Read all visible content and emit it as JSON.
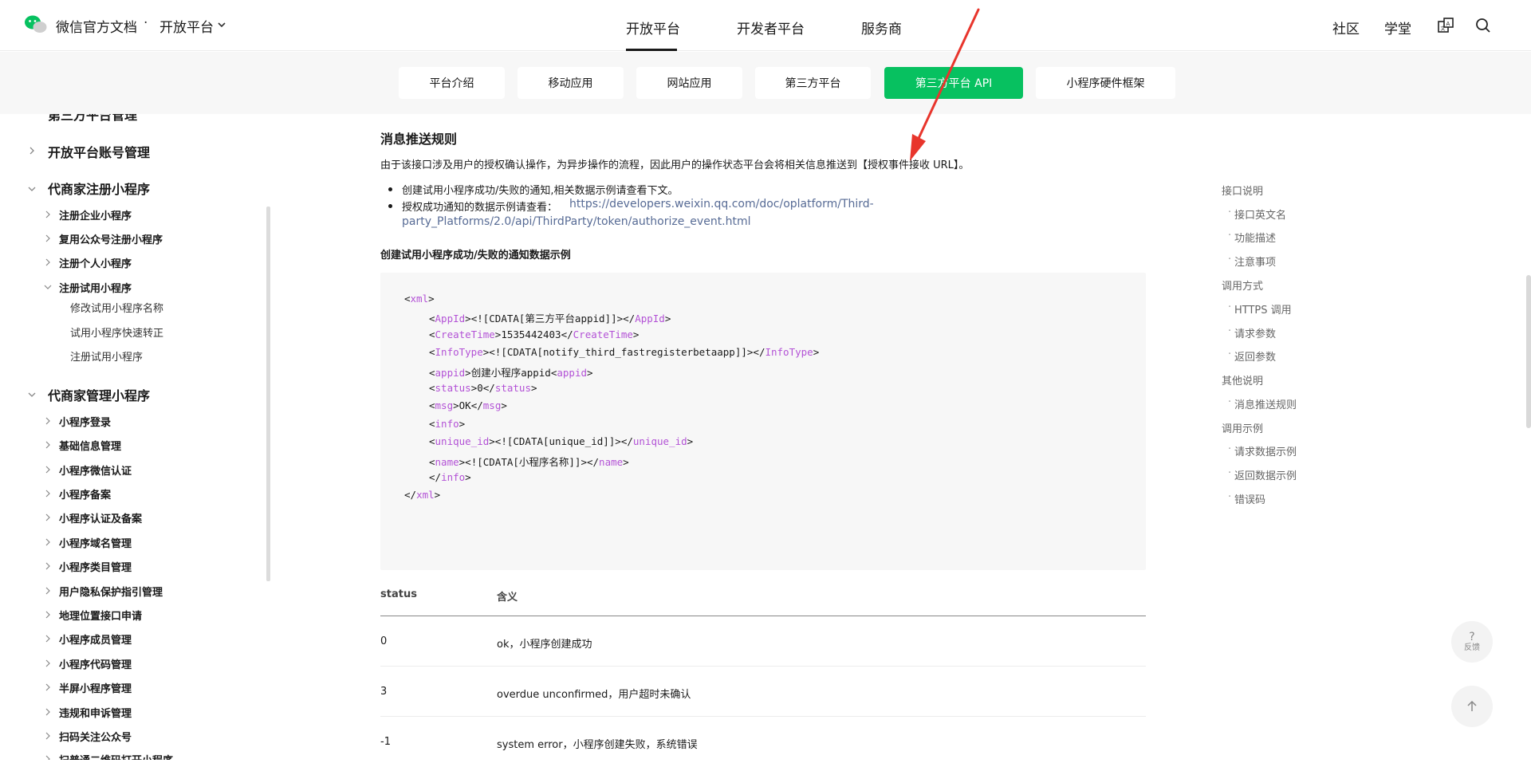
{
  "header": {
    "brand": "微信官方文档",
    "separator": "·",
    "platform": "开放平台",
    "nav": [
      {
        "label": "开放平台"
      },
      {
        "label": "开发者平台"
      },
      {
        "label": "服务商"
      }
    ],
    "right": [
      {
        "label": "社区"
      },
      {
        "label": "学堂"
      }
    ],
    "icons": [
      "logo-icon",
      "chevron-down-icon",
      "translate-icon",
      "search-icon"
    ]
  },
  "subnav": [
    {
      "label": "平台介绍"
    },
    {
      "label": "移动应用"
    },
    {
      "label": "网站应用"
    },
    {
      "label": "第三方平台"
    },
    {
      "label": "第三方平台 API"
    },
    {
      "label": "小程序硬件框架"
    }
  ],
  "sidebar": {
    "partial_top": "第三方平台管理",
    "items": [
      {
        "label": "开放平台账号管理"
      },
      {
        "label": "代商家注册小程序"
      },
      {
        "label": "注册企业小程序"
      },
      {
        "label": "复用公众号注册小程序"
      },
      {
        "label": "注册个人小程序"
      },
      {
        "label": "注册试用小程序"
      },
      {
        "label": "修改试用小程序名称"
      },
      {
        "label": "试用小程序快速转正"
      },
      {
        "label": "注册试用小程序"
      },
      {
        "label": "代商家管理小程序"
      },
      {
        "label": "小程序登录"
      },
      {
        "label": "基础信息管理"
      },
      {
        "label": "小程序微信认证"
      },
      {
        "label": "小程序备案"
      },
      {
        "label": "小程序认证及备案"
      },
      {
        "label": "小程序域名管理"
      },
      {
        "label": "小程序类目管理"
      },
      {
        "label": "用户隐私保护指引管理"
      },
      {
        "label": "地理位置接口申请"
      },
      {
        "label": "小程序成员管理"
      },
      {
        "label": "小程序代码管理"
      },
      {
        "label": "半屏小程序管理"
      },
      {
        "label": "违规和申诉管理"
      },
      {
        "label": "扫码关注公众号"
      },
      {
        "label": "扫普通二维码打开小程序"
      }
    ]
  },
  "content": {
    "title": "消息推送规则",
    "intro": "由于该接口涉及用户的授权确认操作，为异步操作的流程，因此用户的操作状态平台会将相关信息推送到【授权事件接收 URL】。",
    "bullets": {
      "b1": "创建试用小程序成功/失败的通知,相关数据示例请查看下文。",
      "b2_prefix": "授权成功通知的数据示例请查看：",
      "b2_link_line1": "https://developers.weixin.qq.com/doc/oplatform/Third-",
      "b2_link_line2": "party_Platforms/2.0/api/ThirdParty/token/authorize_event.html"
    },
    "example_heading": "创建试用小程序成功/失败的通知数据示例",
    "code": {
      "l1_a": "<",
      "l1_tag": "xml",
      "l1_b": ">",
      "l2_tag": "AppId",
      "l2_val": "<![CDATA[第三方平台appid]]>",
      "l3_tag": "CreateTime",
      "l3_val": "1535442403",
      "l4_tag": "InfoType",
      "l4_val": "<![CDATA[notify_third_fastregisterbetaapp]]>",
      "l5_tag": "appid",
      "l5_val": "创建小程序appid",
      "l6_tag": "status",
      "l6_val": "0",
      "l7_tag": "msg",
      "l7_val": "OK",
      "l8_tag": "info",
      "l9_tag": "unique_id",
      "l9_val": "<![CDATA[unique_id]]>",
      "l10_tag": "name",
      "l10_val": "<![CDATA[小程序名称]]>",
      "l11_tag": "info",
      "l12_tag": "xml"
    },
    "table": {
      "headers": [
        "status",
        "含义"
      ],
      "rows": [
        [
          "0",
          "ok，小程序创建成功"
        ],
        [
          "3",
          "overdue unconfirmed，用户超时未确认"
        ],
        [
          "-1",
          "system error，小程序创建失败，系统错误"
        ]
      ]
    }
  },
  "toc": [
    {
      "label": "接口说明",
      "level": 1
    },
    {
      "label": "接口英文名",
      "level": 2
    },
    {
      "label": "功能描述",
      "level": 2
    },
    {
      "label": "注意事项",
      "level": 2
    },
    {
      "label": "调用方式",
      "level": 1
    },
    {
      "label": "HTTPS 调用",
      "level": 2
    },
    {
      "label": "请求参数",
      "level": 2
    },
    {
      "label": "返回参数",
      "level": 2
    },
    {
      "label": "其他说明",
      "level": 1
    },
    {
      "label": "消息推送规则",
      "level": 2
    },
    {
      "label": "调用示例",
      "level": 1
    },
    {
      "label": "请求数据示例",
      "level": 2
    },
    {
      "label": "返回数据示例",
      "level": 2
    },
    {
      "label": "错误码",
      "level": 2
    }
  ],
  "floating": {
    "feedback_symbol": "?",
    "feedback_label": "反馈"
  },
  "colors": {
    "accent": "#07c160",
    "annotation": "#e8352c",
    "link": "#576b95",
    "xml_tag": "#b352d6"
  }
}
